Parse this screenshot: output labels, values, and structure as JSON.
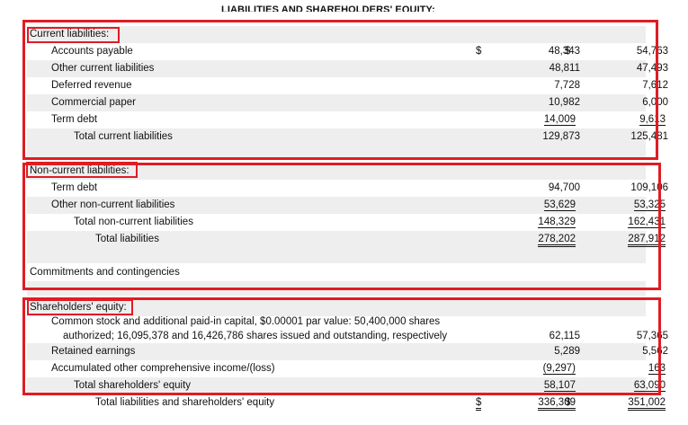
{
  "title": "LIABILITIES AND SHAREHOLDERS' EQUITY:",
  "current": {
    "heading": "Current liabilities:",
    "rows": [
      {
        "label": "Accounts payable",
        "dollar1": "$",
        "v1": "48,343",
        "dollar2": "$",
        "v2": "54,763"
      },
      {
        "label": "Other current liabilities",
        "v1": "48,811",
        "v2": "47,493"
      },
      {
        "label": "Deferred revenue",
        "v1": "7,728",
        "v2": "7,612"
      },
      {
        "label": "Commercial paper",
        "v1": "10,982",
        "v2": "6,000"
      },
      {
        "label": "Term debt",
        "v1": "14,009",
        "v2": "9,613"
      },
      {
        "label": "Total current liabilities",
        "v1": "129,873",
        "v2": "125,481"
      }
    ]
  },
  "noncurrent": {
    "heading": "Non-current liabilities:",
    "rows": [
      {
        "label": "Term debt",
        "v1": "94,700",
        "v2": "109,106"
      },
      {
        "label": "Other non-current liabilities",
        "v1": "53,629",
        "v2": "53,325"
      },
      {
        "label": "Total non-current liabilities",
        "v1": "148,329",
        "v2": "162,431"
      },
      {
        "label": "Total liabilities",
        "v1": "278,202",
        "v2": "287,912"
      }
    ],
    "commitments": "Commitments and contingencies"
  },
  "equity": {
    "heading": "Shareholders' equity:",
    "common_line1": "Common stock and additional paid-in capital, $0.00001 par value: 50,400,000 shares",
    "common_line2": "authorized; 16,095,378 and 16,426,786 shares issued and outstanding, respectively",
    "common_v1": "62,115",
    "common_v2": "57,365",
    "rows": [
      {
        "label": "Retained earnings",
        "v1": "5,289",
        "v2": "5,562"
      },
      {
        "label": "Accumulated other comprehensive income/(loss)",
        "v1": "(9,297)",
        "v2": "163"
      },
      {
        "label": "Total shareholders' equity",
        "v1": "58,107",
        "v2": "63,090"
      }
    ],
    "grand_total": {
      "label": "Total liabilities and shareholders' equity",
      "dollar1": "$",
      "v1": "336,309",
      "dollar2": "$",
      "v2": "351,002"
    }
  },
  "colors": {
    "highlight": "#e01c24",
    "shade": "#eeeeee"
  }
}
